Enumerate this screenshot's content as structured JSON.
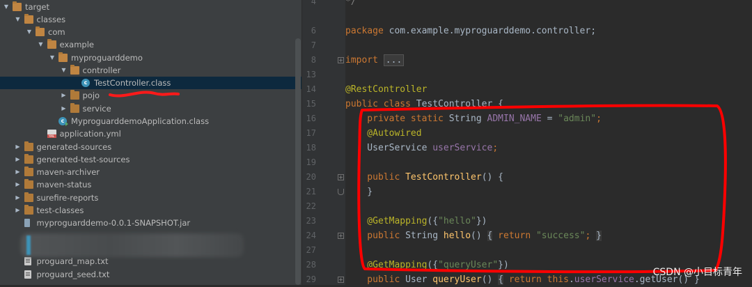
{
  "tree": {
    "items": [
      {
        "label": "target",
        "kind": "folder",
        "open": true
      },
      {
        "label": "classes",
        "kind": "folder",
        "open": true
      },
      {
        "label": "com",
        "kind": "folder",
        "open": true
      },
      {
        "label": "example",
        "kind": "folder",
        "open": true
      },
      {
        "label": "myproguarddemo",
        "kind": "folder",
        "open": true
      },
      {
        "label": "controller",
        "kind": "folder",
        "open": true
      },
      {
        "label": "TestController.class",
        "kind": "class",
        "selected": true
      },
      {
        "label": "pojo",
        "kind": "folder",
        "open": false
      },
      {
        "label": "service",
        "kind": "folder",
        "open": false
      },
      {
        "label": "MyproguarddemoApplication.class",
        "kind": "class-main"
      },
      {
        "label": "application.yml",
        "kind": "yml"
      },
      {
        "label": "generated-sources",
        "kind": "folder",
        "open": false
      },
      {
        "label": "generated-test-sources",
        "kind": "folder",
        "open": false
      },
      {
        "label": "maven-archiver",
        "kind": "folder",
        "open": false
      },
      {
        "label": "maven-status",
        "kind": "folder",
        "open": false
      },
      {
        "label": "surefire-reports",
        "kind": "folder",
        "open": false
      },
      {
        "label": "test-classes",
        "kind": "folder",
        "open": false
      },
      {
        "label": "myproguarddemo-0.0.1-SNAPSHOT.jar",
        "kind": "jar"
      },
      {
        "label": "proguard_map.txt",
        "kind": "txt"
      },
      {
        "label": "proguard_seed.txt",
        "kind": "txt"
      }
    ]
  },
  "editor": {
    "line_numbers": [
      "4",
      "6",
      "7",
      "8",
      "13",
      "14",
      "15",
      "16",
      "17",
      "18",
      "19",
      "20",
      "21",
      "22",
      "23",
      "24",
      "27",
      "28",
      "29"
    ],
    "lines": {
      "l4": "*/",
      "l6_kw": "package",
      "l6_rest": " com.example.myproguarddemo.controller;",
      "l8_kw": "import",
      "l8_fold": "...",
      "l14": "@RestController",
      "l15_kw": "public class",
      "l15_rest": " TestController {",
      "l16_kw": "    private static",
      "l16_mid": " String ",
      "l16_field": "ADMIN_NAME",
      "l16_eq": " = ",
      "l16_str": "\"admin\"",
      "l16_end": ";",
      "l17": "    @Autowired",
      "l18_a": "    UserService ",
      "l18_field": "userService",
      "l18_end": ";",
      "l20_kw": "    public",
      "l20_fn": " TestController",
      "l20_rest": "() {",
      "l21": "    }",
      "l23_ann": "    @GetMapping",
      "l23_p1": "({",
      "l23_str": "\"hello\"",
      "l23_p2": "})",
      "l24_kw": "    public",
      "l24_mid": " String ",
      "l24_fn": "hello",
      "l24_p": "() ",
      "l24_open": "{",
      "l24_kw2": " return ",
      "l24_str": "\"success\"",
      "l24_semi": "; ",
      "l24_close": "}",
      "l28_ann": "    @GetMapping",
      "l28_p1": "({",
      "l28_str": "\"queryUser\"",
      "l28_p2": "})",
      "l29_kw": "    public",
      "l29_mid": " User ",
      "l29_fn": "queryUser",
      "l29_p": "() ",
      "l29_open": "{",
      "l29_kw2": " return this",
      "l29_dot": ".",
      "l29_field": "userService",
      "l29_rest": ".getUser() }"
    }
  },
  "watermark": "CSDN @小目标青年",
  "colors": {
    "annotation_red": "#ff0000",
    "selection": "#0d293e"
  }
}
